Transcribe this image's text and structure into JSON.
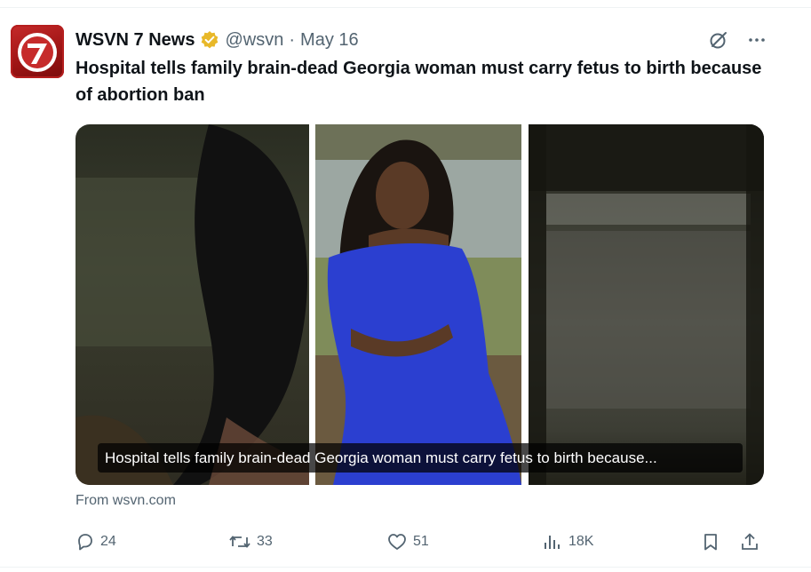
{
  "post": {
    "author": {
      "display_name": "WSVN 7 News",
      "handle": "@wsvn",
      "separator": "·",
      "date": "May 16"
    },
    "text": "Hospital tells family brain-dead Georgia woman must carry fetus to birth because of abortion ban",
    "media": {
      "caption": "Hospital tells family brain-dead Georgia woman must carry fetus to birth because..."
    },
    "source": "From wsvn.com",
    "metrics": {
      "replies": "24",
      "reposts": "33",
      "likes": "51",
      "views": "18K"
    }
  },
  "colors": {
    "text": "#0f1419",
    "muted": "#536471",
    "verified": "#e8b829",
    "brand_red": "#c62b2b",
    "dress_blue": "#2b3fd0"
  },
  "icons": [
    "wsvn-7-logo",
    "verified-badge-icon",
    "grok-icon",
    "more-icon",
    "reply-icon",
    "repost-icon",
    "like-icon",
    "views-icon",
    "bookmark-icon",
    "share-icon"
  ]
}
